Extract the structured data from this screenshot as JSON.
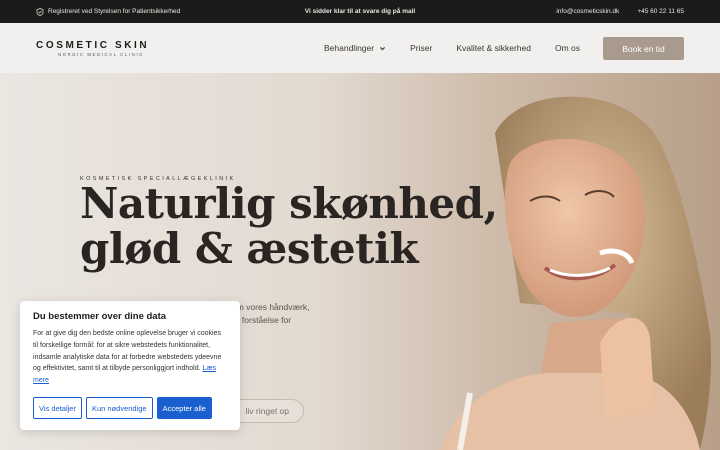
{
  "topbar": {
    "left_text": "Registreret ved Styrelsen for Patientsikkerhed",
    "center_text": "Vi sidder klar til at svare dig på mail",
    "email": "info@cosmeticskin.dk",
    "phone": "+45 60 22 11 65"
  },
  "header": {
    "brand": "COSMETIC SKIN",
    "tagline": "NORDIC MEDICAL CLINIC",
    "nav": [
      {
        "label": "Behandlinger",
        "has_dropdown": true
      },
      {
        "label": "Priser"
      },
      {
        "label": "Kvalitet & sikkerhed"
      },
      {
        "label": "Om os"
      }
    ],
    "cta": "Book en tid"
  },
  "hero": {
    "eyebrow": "KOSMETISK SPECIALLÆGEKLINIK",
    "headline_line1": "Naturlig skønhed,",
    "headline_line2": "glød & æstetik",
    "body_line1": "em vores håndværk,",
    "body_line2": "or forståelse for",
    "secondary_cta": "liv ringet op"
  },
  "cookie": {
    "title": "Du bestemmer over dine data",
    "text": "For at give dig den bedste online oplevelse bruger vi cookies til forskellige formål: for at sikre webstedets funktionalitet, indsamle analytiske data for at forbedre webstedets ydeevne og effektivitet, samt til at tilbyde personliggjort indhold.",
    "link": "Læs mere",
    "buttons": {
      "details": "Vis detaljer",
      "necessary": "Kun nødvendige",
      "accept": "Accepter alle"
    }
  },
  "colors": {
    "topbar_bg": "#1c1b1a",
    "cta_bg": "#a89a8c",
    "cookie_accent": "#1a5fcf"
  }
}
